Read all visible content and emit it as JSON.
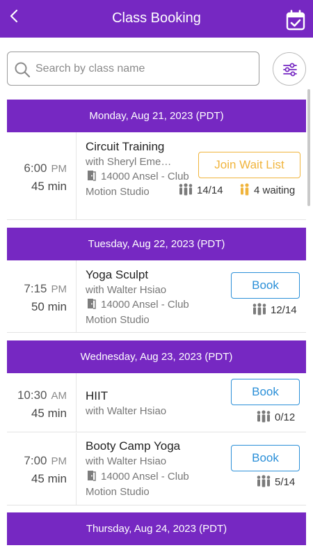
{
  "header": {
    "title": "Class Booking",
    "back_icon": "chevron-left-icon",
    "calendar_icon": "calendar-check-icon"
  },
  "search": {
    "placeholder": "Search by class name",
    "value": ""
  },
  "colors": {
    "brand_purple": "#7628c2",
    "book_blue": "#2a8fd8",
    "waitlist_amber": "#f0b43c"
  },
  "days": [
    {
      "label": "Monday, Aug 21, 2023 (PDT)",
      "classes": [
        {
          "time": "6:00",
          "ampm": "PM",
          "duration": "45 min",
          "name": "Circuit Training",
          "instructor": "with Sheryl Eme…",
          "location": "14000 Ansel - Club Motion Studio",
          "action": "Join Wait List",
          "capacity": "14/14",
          "waiting": "4 waiting"
        }
      ]
    },
    {
      "label": "Tuesday, Aug 22, 2023 (PDT)",
      "classes": [
        {
          "time": "7:15",
          "ampm": "PM",
          "duration": "50 min",
          "name": "Yoga Sculpt",
          "instructor": "with Walter Hsiao",
          "location": "14000 Ansel - Club Motion Studio",
          "action": "Book",
          "capacity": "12/14"
        }
      ]
    },
    {
      "label": "Wednesday, Aug 23, 2023 (PDT)",
      "classes": [
        {
          "time": "10:30",
          "ampm": "AM",
          "duration": "45 min",
          "name": "HIIT",
          "instructor": "with Walter Hsiao",
          "action": "Book",
          "capacity": "0/12"
        },
        {
          "time": "7:00",
          "ampm": "PM",
          "duration": "45 min",
          "name": "Booty Camp Yoga",
          "instructor": "with Walter Hsiao",
          "location": "14000 Ansel - Club Motion Studio",
          "action": "Book",
          "capacity": "5/14"
        }
      ]
    },
    {
      "label": "Thursday, Aug 24, 2023 (PDT)",
      "classes": []
    }
  ]
}
